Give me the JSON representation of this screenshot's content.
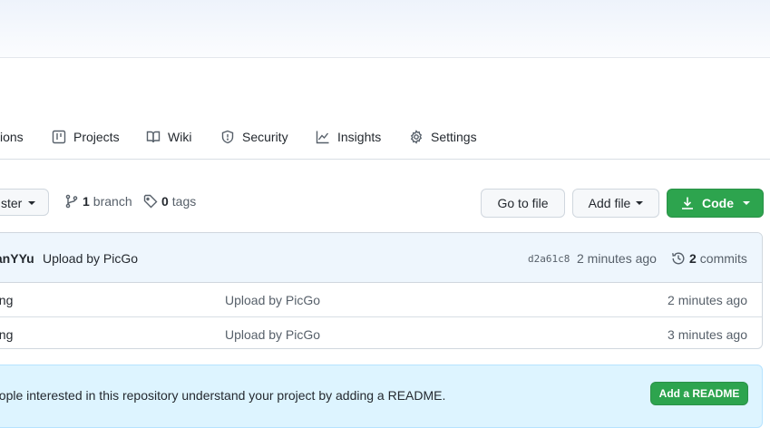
{
  "tabs": [
    {
      "label": "ions",
      "icon": "actions-icon"
    },
    {
      "label": "Projects",
      "icon": "project-table-icon"
    },
    {
      "label": "Wiki",
      "icon": "book-icon"
    },
    {
      "label": "Security",
      "icon": "shield-icon"
    },
    {
      "label": "Insights",
      "icon": "graph-icon"
    },
    {
      "label": "Settings",
      "icon": "gear-icon"
    }
  ],
  "branch_selector": {
    "label": "ster"
  },
  "meta": {
    "branch_count": "1",
    "branch_label": "branch",
    "tag_count": "0",
    "tag_label": "tags"
  },
  "actions": {
    "go_to_file": "Go to file",
    "add_file": "Add file",
    "code": "Code"
  },
  "latest_commit": {
    "author": "lanYYu",
    "message": "Upload by PicGo",
    "sha": "d2a61c8",
    "ago": "2 minutes ago",
    "commit_count": "2",
    "commit_label": "commits"
  },
  "files": [
    {
      "name": "ong",
      "message": "Upload by PicGo",
      "time": "2 minutes ago"
    },
    {
      "name": "ong",
      "message": "Upload by PicGo",
      "time": "3 minutes ago"
    }
  ],
  "readme_banner": {
    "text": "eople interested in this repository understand your project by adding a README.",
    "button": "Add a README"
  },
  "colors": {
    "primary_green": "#2da44e",
    "banner_blue": "#ddf4ff"
  }
}
